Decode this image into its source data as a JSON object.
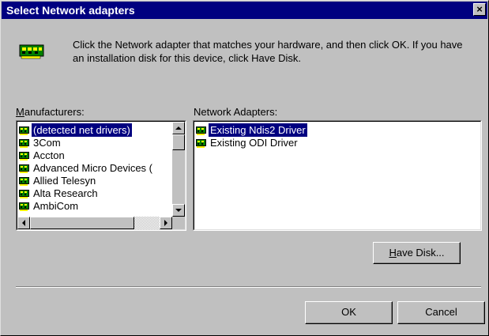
{
  "window": {
    "title": "Select Network adapters",
    "close_label": "×"
  },
  "instructions": "Click the Network adapter that matches your hardware, and then click OK. If you have an installation disk for this device, click Have Disk.",
  "manufacturers": {
    "label_ul": "M",
    "label_rest": "anufacturers:",
    "items": [
      {
        "label": "(detected net drivers)",
        "selected": true
      },
      {
        "label": "3Com",
        "selected": false
      },
      {
        "label": "Accton",
        "selected": false
      },
      {
        "label": "Advanced Micro Devices (",
        "selected": false
      },
      {
        "label": "Allied Telesyn",
        "selected": false
      },
      {
        "label": "Alta Research",
        "selected": false
      },
      {
        "label": "AmbiCom",
        "selected": false
      }
    ]
  },
  "adapters": {
    "label": "Network Adapters:",
    "items": [
      {
        "label": "Existing Ndis2 Driver",
        "selected": true
      },
      {
        "label": "Existing ODI Driver",
        "selected": false
      }
    ]
  },
  "buttons": {
    "have_disk_ul": "H",
    "have_disk_rest": "ave Disk...",
    "ok": "OK",
    "cancel": "Cancel"
  },
  "icons": {
    "network_adapter": "network-adapter-icon"
  }
}
